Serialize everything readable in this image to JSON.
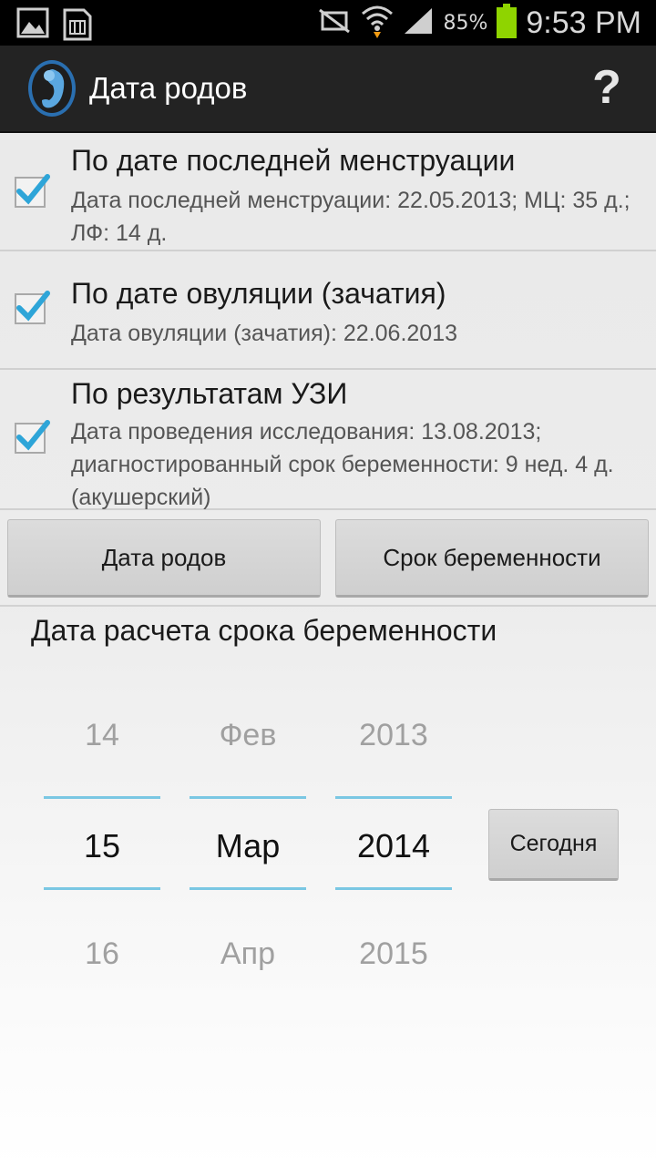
{
  "status_bar": {
    "battery_percent": "85%",
    "time": "9:53 PM",
    "icons": [
      "gallery-icon",
      "sim-card-icon",
      "mute-icon",
      "wifi-icon",
      "signal-icon",
      "battery-icon"
    ]
  },
  "action_bar": {
    "title": "Дата родов",
    "help_label": "?"
  },
  "methods": [
    {
      "title": "По дате последней менструации",
      "subtitle": "Дата последней менструации: 22.05.2013; МЦ: 35 д.; ЛФ: 14 д.",
      "checked": true
    },
    {
      "title": "По дате овуляции (зачатия)",
      "subtitle": "Дата овуляции (зачатия): 22.06.2013",
      "checked": true
    },
    {
      "title": "По результатам УЗИ",
      "subtitle": "Дата проведения исследования: 13.08.2013; диагностированный срок беременности: 9 нед. 4 д. (акушерский)",
      "checked": true
    }
  ],
  "buttons": {
    "due_date": "Дата родов",
    "pregnancy_term": "Срок беременности"
  },
  "calc_date": {
    "title": "Дата расчета срока беременности",
    "day": {
      "prev": "14",
      "current": "15",
      "next": "16"
    },
    "month": {
      "prev": "Фев",
      "current": "Мар",
      "next": "Апр"
    },
    "year": {
      "prev": "2013",
      "current": "2014",
      "next": "2015"
    },
    "today_button": "Сегодня"
  },
  "colors": {
    "accent": "#33b5e5",
    "picker_line": "#7ac7e3",
    "battery": "#8fd400"
  }
}
